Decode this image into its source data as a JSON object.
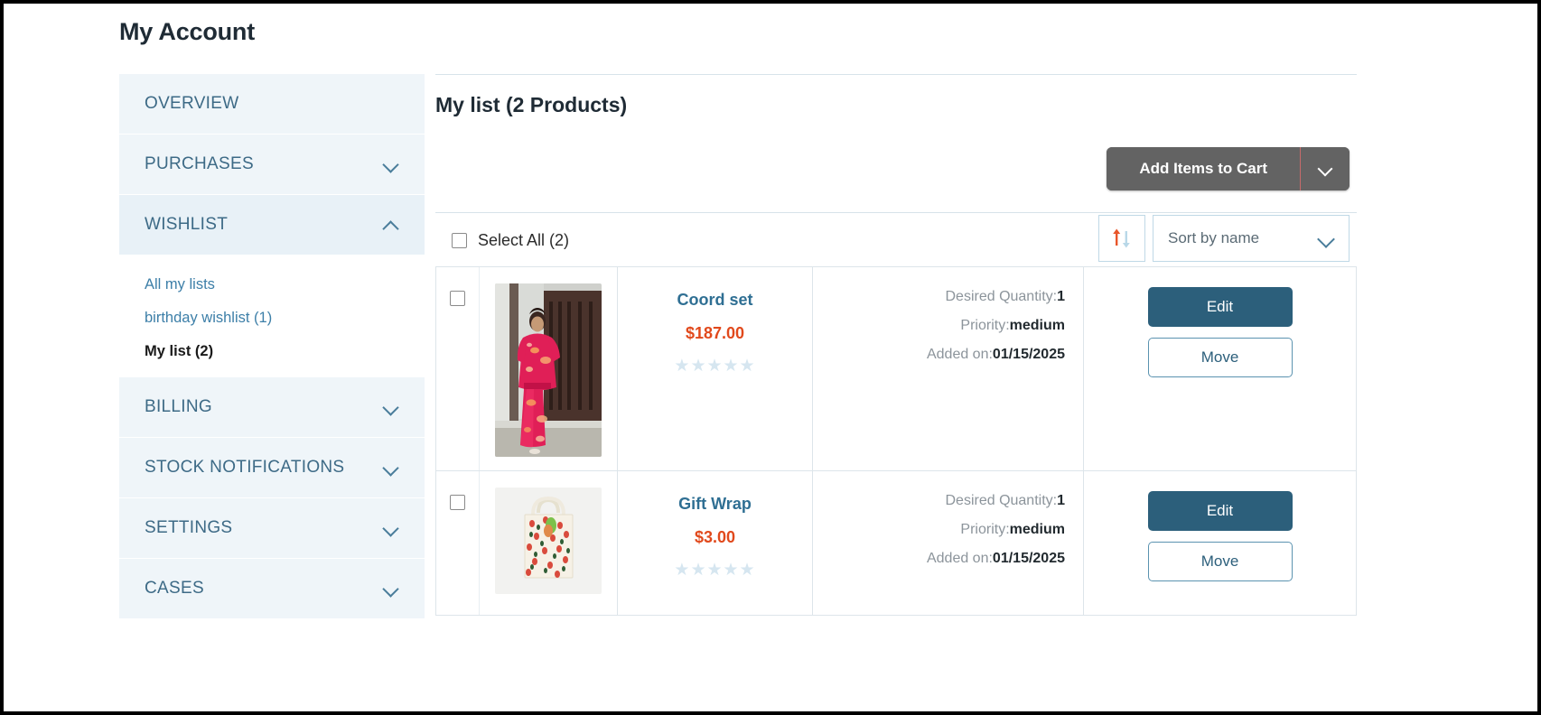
{
  "page": {
    "title": "My Account"
  },
  "sidebar": {
    "items": [
      {
        "label": "OVERVIEW",
        "icon": "",
        "expandable": false,
        "expanded": false
      },
      {
        "label": "PURCHASES",
        "icon": "chevron-down-icon",
        "expandable": true,
        "expanded": false
      },
      {
        "label": "WISHLIST",
        "icon": "chevron-up-icon",
        "expandable": true,
        "expanded": true
      },
      {
        "label": "BILLING",
        "icon": "chevron-down-icon",
        "expandable": true,
        "expanded": false
      },
      {
        "label": "STOCK NOTIFICATIONS",
        "icon": "chevron-down-icon",
        "expandable": true,
        "expanded": false
      },
      {
        "label": "SETTINGS",
        "icon": "chevron-down-icon",
        "expandable": true,
        "expanded": false
      },
      {
        "label": "CASES",
        "icon": "chevron-down-icon",
        "expandable": true,
        "expanded": false
      }
    ],
    "wishlist_sub_items": [
      {
        "label": "All my lists",
        "active": false
      },
      {
        "label": "birthday wishlist (1)",
        "active": false
      },
      {
        "label": "My list (2)",
        "active": true
      }
    ]
  },
  "main": {
    "list_title": "My list (2 Products)",
    "add_items_to_cart_label": "Add Items to Cart",
    "add_items_caret_icon": "chevron-down-icon",
    "sort_toggle_icon": "sort-ascending-descending-icon",
    "sort_select_value": "Sort by name",
    "sort_select_caret_icon": "chevron-down-icon",
    "select_all_label": "Select All (2)",
    "select_all_checked": false
  },
  "products": [
    {
      "name": "Coord set",
      "price": "$187.00",
      "rating": 0,
      "rating_max": 5,
      "selected": false,
      "image_alt": "woman-in-pink-floral-coord-set",
      "desired_quantity_label": "Desired Quantity:",
      "desired_quantity_value": "1",
      "priority_label": "Priority:",
      "priority_value": "medium",
      "added_on_label": "Added on:",
      "added_on_value": "01/15/2025",
      "edit_label": "Edit",
      "move_label": "Move"
    },
    {
      "name": "Gift Wrap",
      "price": "$3.00",
      "rating": 0,
      "rating_max": 5,
      "selected": false,
      "image_alt": "floral-print-tote-gift-bag",
      "desired_quantity_label": "Desired Quantity:",
      "desired_quantity_value": "1",
      "priority_label": "Priority:",
      "priority_value": "medium",
      "added_on_label": "Added on:",
      "added_on_value": "01/15/2025",
      "edit_label": "Edit",
      "move_label": "Move"
    }
  ],
  "colors": {
    "sidebar_bg": "#eff5f9",
    "sidebar_text": "#3d6a86",
    "link_blue": "#3d7fa8",
    "price_orange": "#e1491c",
    "primary_button": "#2c5f7b",
    "cart_button_grey": "#636363",
    "star_empty": "#d6e6f0",
    "border": "#dde5ea"
  }
}
